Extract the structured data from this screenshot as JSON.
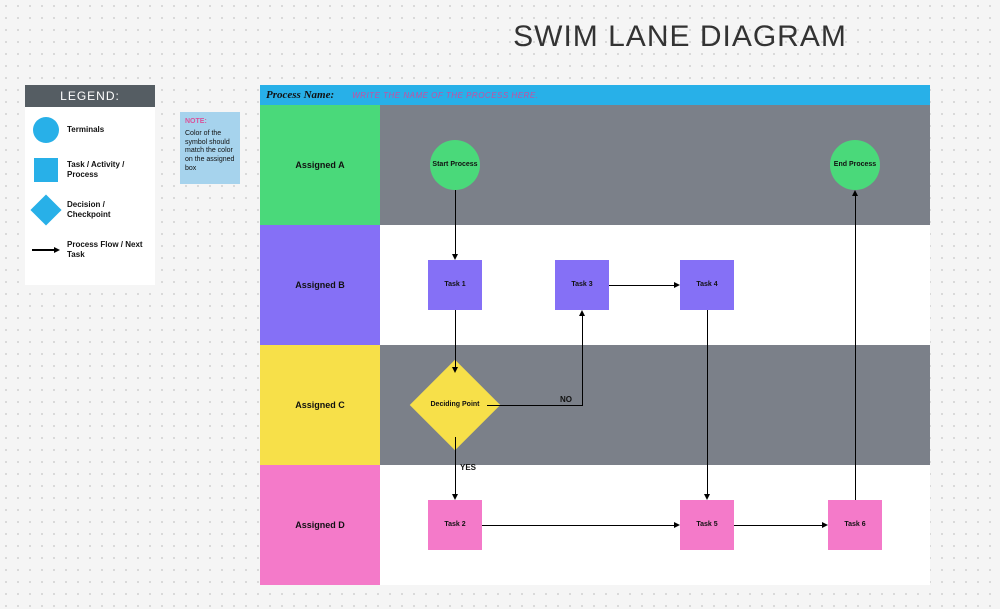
{
  "title": "SWIM LANE DIAGRAM",
  "legend": {
    "header": "LEGEND:",
    "terminals": "Terminals",
    "task": "Task / Activity / Process",
    "decision": "Decision / Checkpoint",
    "flow": "Process Flow / Next Task"
  },
  "note": {
    "header": "NOTE:",
    "text": "Color of the symbol should match the color on the assigned box"
  },
  "process": {
    "label": "Process Name:",
    "hint": "WRITE THE NAME OF THE PROCESS HERE."
  },
  "lanes": {
    "a": "Assigned A",
    "b": "Assigned B",
    "c": "Assigned C",
    "d": "Assigned D"
  },
  "nodes": {
    "start": "Start Process",
    "end": "End Process",
    "task1": "Task 1",
    "task2": "Task 2",
    "task3": "Task 3",
    "task4": "Task 4",
    "task5": "Task 5",
    "task6": "Task 6",
    "decide": "Deciding Point"
  },
  "edges": {
    "yes": "YES",
    "no": "NO"
  },
  "chart_data": {
    "type": "swimlane",
    "title": "SWIM LANE DIAGRAM",
    "lanes": [
      "Assigned A",
      "Assigned B",
      "Assigned C",
      "Assigned D"
    ],
    "nodes": [
      {
        "id": "start",
        "label": "Start Process",
        "type": "terminal",
        "lane": "Assigned A"
      },
      {
        "id": "task1",
        "label": "Task 1",
        "type": "task",
        "lane": "Assigned B"
      },
      {
        "id": "decide",
        "label": "Deciding Point",
        "type": "decision",
        "lane": "Assigned C"
      },
      {
        "id": "task2",
        "label": "Task 2",
        "type": "task",
        "lane": "Assigned D"
      },
      {
        "id": "task3",
        "label": "Task 3",
        "type": "task",
        "lane": "Assigned B"
      },
      {
        "id": "task4",
        "label": "Task 4",
        "type": "task",
        "lane": "Assigned B"
      },
      {
        "id": "task5",
        "label": "Task 5",
        "type": "task",
        "lane": "Assigned D"
      },
      {
        "id": "task6",
        "label": "Task 6",
        "type": "task",
        "lane": "Assigned D"
      },
      {
        "id": "end",
        "label": "End Process",
        "type": "terminal",
        "lane": "Assigned A"
      }
    ],
    "edges": [
      {
        "from": "start",
        "to": "task1"
      },
      {
        "from": "task1",
        "to": "decide"
      },
      {
        "from": "decide",
        "to": "task2",
        "label": "YES"
      },
      {
        "from": "decide",
        "to": "task3",
        "label": "NO"
      },
      {
        "from": "task3",
        "to": "task4"
      },
      {
        "from": "task4",
        "to": "task5"
      },
      {
        "from": "task2",
        "to": "task5"
      },
      {
        "from": "task5",
        "to": "task6"
      },
      {
        "from": "task6",
        "to": "end"
      }
    ]
  }
}
